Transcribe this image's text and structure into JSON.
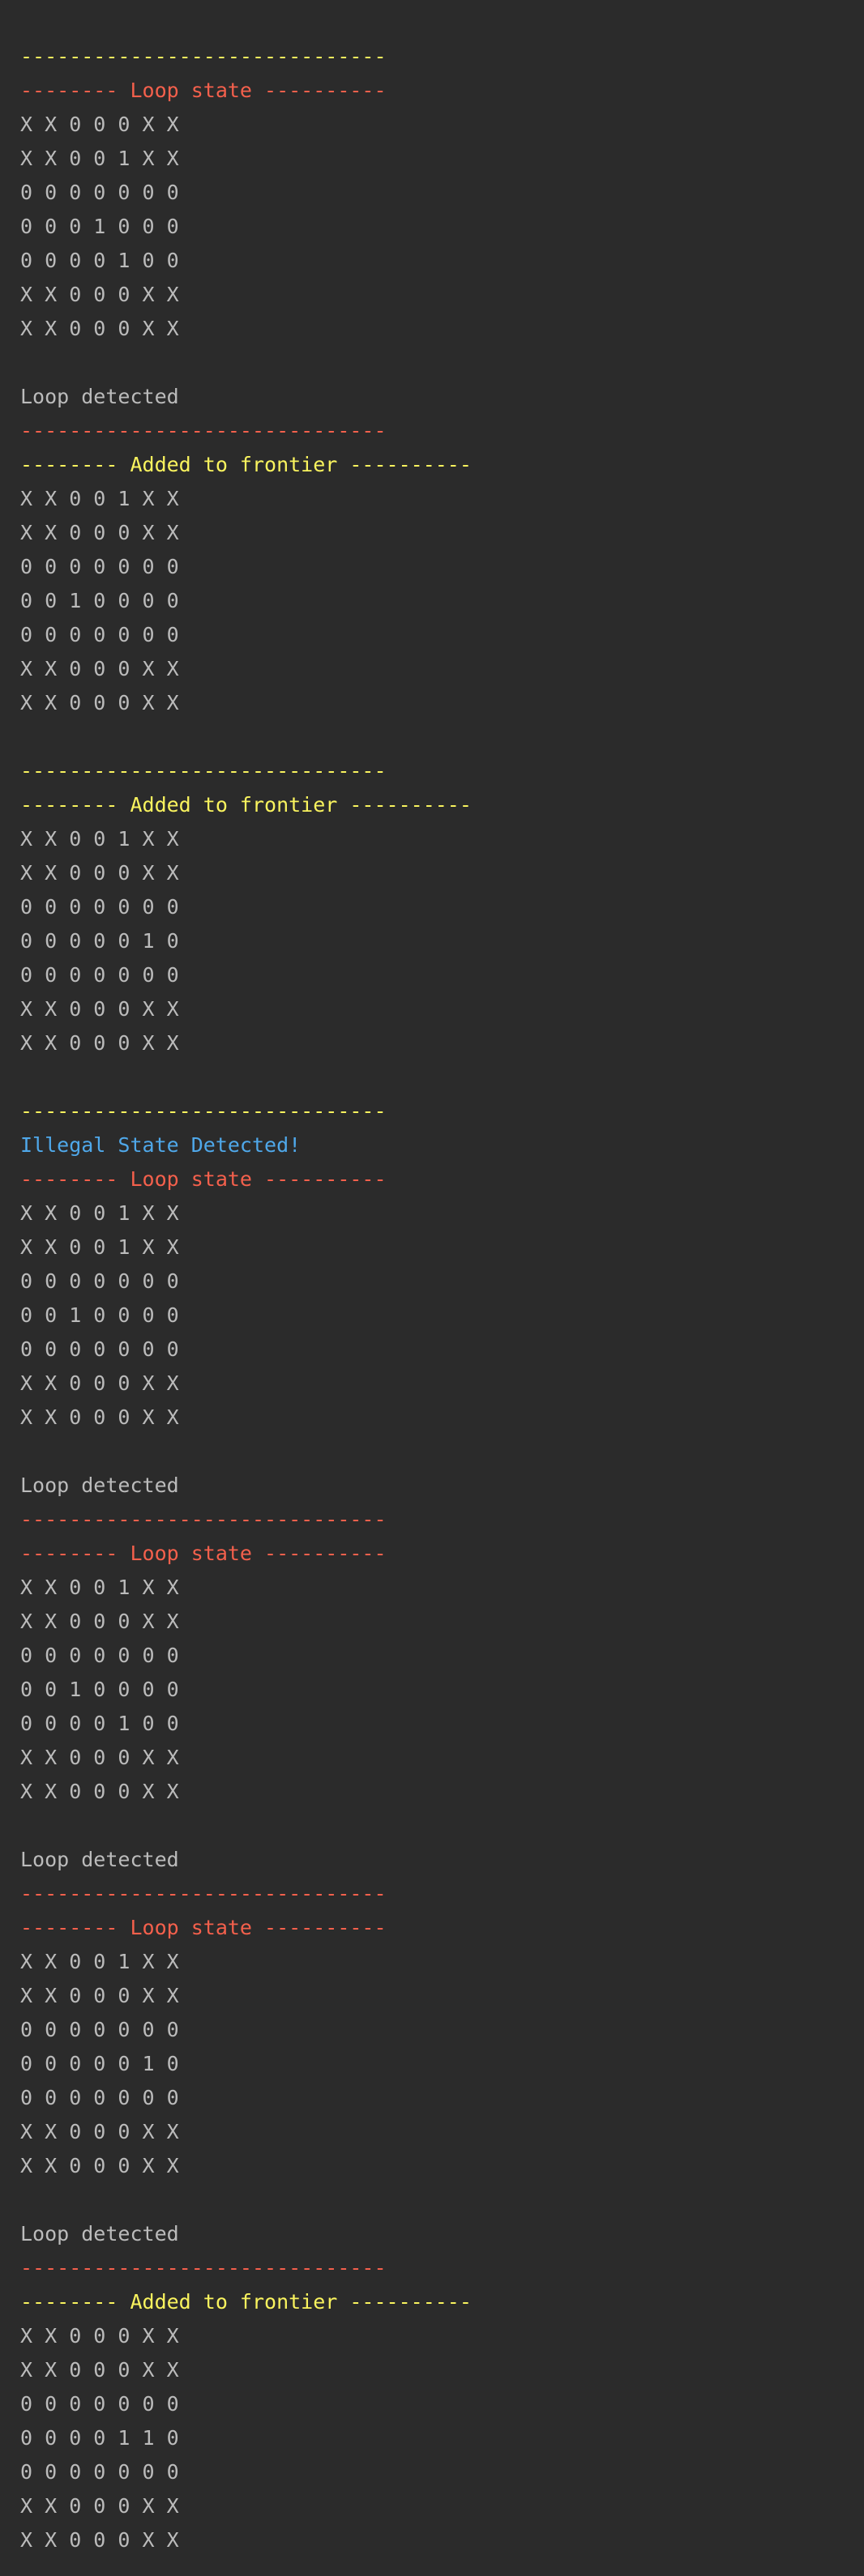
{
  "colors": {
    "background": "#2b2b2b",
    "default": "#bbbbbb",
    "yellow": "#f9f35e",
    "red": "#f4604c",
    "blue": "#4fa8ea"
  },
  "console": {
    "lines": [
      {
        "text": "------------------------------",
        "color": "yellow",
        "name": "separator-line"
      },
      {
        "text": "-------- Loop state ----------",
        "color": "red",
        "name": "loop-state-header"
      },
      {
        "text": "X X 0 0 0 X X",
        "color": "default",
        "name": "grid-row"
      },
      {
        "text": "X X 0 0 1 X X",
        "color": "default",
        "name": "grid-row"
      },
      {
        "text": "0 0 0 0 0 0 0",
        "color": "default",
        "name": "grid-row"
      },
      {
        "text": "0 0 0 1 0 0 0",
        "color": "default",
        "name": "grid-row"
      },
      {
        "text": "0 0 0 0 1 0 0",
        "color": "default",
        "name": "grid-row"
      },
      {
        "text": "X X 0 0 0 X X",
        "color": "default",
        "name": "grid-row"
      },
      {
        "text": "X X 0 0 0 X X",
        "color": "default",
        "name": "grid-row"
      },
      {
        "text": "",
        "color": "default",
        "name": "blank-line"
      },
      {
        "text": "Loop detected",
        "color": "default",
        "name": "loop-detected-message"
      },
      {
        "text": "------------------------------",
        "color": "red",
        "name": "separator-line"
      },
      {
        "text": "-------- Added to frontier ----------",
        "color": "yellow",
        "name": "added-to-frontier-header"
      },
      {
        "text": "X X 0 0 1 X X",
        "color": "default",
        "name": "grid-row"
      },
      {
        "text": "X X 0 0 0 X X",
        "color": "default",
        "name": "grid-row"
      },
      {
        "text": "0 0 0 0 0 0 0",
        "color": "default",
        "name": "grid-row"
      },
      {
        "text": "0 0 1 0 0 0 0",
        "color": "default",
        "name": "grid-row"
      },
      {
        "text": "0 0 0 0 0 0 0",
        "color": "default",
        "name": "grid-row"
      },
      {
        "text": "X X 0 0 0 X X",
        "color": "default",
        "name": "grid-row"
      },
      {
        "text": "X X 0 0 0 X X",
        "color": "default",
        "name": "grid-row"
      },
      {
        "text": "",
        "color": "default",
        "name": "blank-line"
      },
      {
        "text": "------------------------------",
        "color": "yellow",
        "name": "separator-line"
      },
      {
        "text": "-------- Added to frontier ----------",
        "color": "yellow",
        "name": "added-to-frontier-header"
      },
      {
        "text": "X X 0 0 1 X X",
        "color": "default",
        "name": "grid-row"
      },
      {
        "text": "X X 0 0 0 X X",
        "color": "default",
        "name": "grid-row"
      },
      {
        "text": "0 0 0 0 0 0 0",
        "color": "default",
        "name": "grid-row"
      },
      {
        "text": "0 0 0 0 0 1 0",
        "color": "default",
        "name": "grid-row"
      },
      {
        "text": "0 0 0 0 0 0 0",
        "color": "default",
        "name": "grid-row"
      },
      {
        "text": "X X 0 0 0 X X",
        "color": "default",
        "name": "grid-row"
      },
      {
        "text": "X X 0 0 0 X X",
        "color": "default",
        "name": "grid-row"
      },
      {
        "text": "",
        "color": "default",
        "name": "blank-line"
      },
      {
        "text": "------------------------------",
        "color": "yellow",
        "name": "separator-line"
      },
      {
        "text": "Illegal State Detected!",
        "color": "blue",
        "name": "illegal-state-message"
      },
      {
        "text": "-------- Loop state ----------",
        "color": "red",
        "name": "loop-state-header"
      },
      {
        "text": "X X 0 0 1 X X",
        "color": "default",
        "name": "grid-row"
      },
      {
        "text": "X X 0 0 1 X X",
        "color": "default",
        "name": "grid-row"
      },
      {
        "text": "0 0 0 0 0 0 0",
        "color": "default",
        "name": "grid-row"
      },
      {
        "text": "0 0 1 0 0 0 0",
        "color": "default",
        "name": "grid-row"
      },
      {
        "text": "0 0 0 0 0 0 0",
        "color": "default",
        "name": "grid-row"
      },
      {
        "text": "X X 0 0 0 X X",
        "color": "default",
        "name": "grid-row"
      },
      {
        "text": "X X 0 0 0 X X",
        "color": "default",
        "name": "grid-row"
      },
      {
        "text": "",
        "color": "default",
        "name": "blank-line"
      },
      {
        "text": "Loop detected",
        "color": "default",
        "name": "loop-detected-message"
      },
      {
        "text": "------------------------------",
        "color": "red",
        "name": "separator-line"
      },
      {
        "text": "-------- Loop state ----------",
        "color": "red",
        "name": "loop-state-header"
      },
      {
        "text": "X X 0 0 1 X X",
        "color": "default",
        "name": "grid-row"
      },
      {
        "text": "X X 0 0 0 X X",
        "color": "default",
        "name": "grid-row"
      },
      {
        "text": "0 0 0 0 0 0 0",
        "color": "default",
        "name": "grid-row"
      },
      {
        "text": "0 0 1 0 0 0 0",
        "color": "default",
        "name": "grid-row"
      },
      {
        "text": "0 0 0 0 1 0 0",
        "color": "default",
        "name": "grid-row"
      },
      {
        "text": "X X 0 0 0 X X",
        "color": "default",
        "name": "grid-row"
      },
      {
        "text": "X X 0 0 0 X X",
        "color": "default",
        "name": "grid-row"
      },
      {
        "text": "",
        "color": "default",
        "name": "blank-line"
      },
      {
        "text": "Loop detected",
        "color": "default",
        "name": "loop-detected-message"
      },
      {
        "text": "------------------------------",
        "color": "red",
        "name": "separator-line"
      },
      {
        "text": "-------- Loop state ----------",
        "color": "red",
        "name": "loop-state-header"
      },
      {
        "text": "X X 0 0 1 X X",
        "color": "default",
        "name": "grid-row"
      },
      {
        "text": "X X 0 0 0 X X",
        "color": "default",
        "name": "grid-row"
      },
      {
        "text": "0 0 0 0 0 0 0",
        "color": "default",
        "name": "grid-row"
      },
      {
        "text": "0 0 0 0 0 1 0",
        "color": "default",
        "name": "grid-row"
      },
      {
        "text": "0 0 0 0 0 0 0",
        "color": "default",
        "name": "grid-row"
      },
      {
        "text": "X X 0 0 0 X X",
        "color": "default",
        "name": "grid-row"
      },
      {
        "text": "X X 0 0 0 X X",
        "color": "default",
        "name": "grid-row"
      },
      {
        "text": "",
        "color": "default",
        "name": "blank-line"
      },
      {
        "text": "Loop detected",
        "color": "default",
        "name": "loop-detected-message"
      },
      {
        "text": "------------------------------",
        "color": "red",
        "name": "separator-line"
      },
      {
        "text": "-------- Added to frontier ----------",
        "color": "yellow",
        "name": "added-to-frontier-header"
      },
      {
        "text": "X X 0 0 0 X X",
        "color": "default",
        "name": "grid-row"
      },
      {
        "text": "X X 0 0 0 X X",
        "color": "default",
        "name": "grid-row"
      },
      {
        "text": "0 0 0 0 0 0 0",
        "color": "default",
        "name": "grid-row"
      },
      {
        "text": "0 0 0 0 1 1 0",
        "color": "default",
        "name": "grid-row"
      },
      {
        "text": "0 0 0 0 0 0 0",
        "color": "default",
        "name": "grid-row"
      },
      {
        "text": "X X 0 0 0 X X",
        "color": "default",
        "name": "grid-row"
      },
      {
        "text": "X X 0 0 0 X X",
        "color": "default",
        "name": "grid-row"
      }
    ]
  }
}
